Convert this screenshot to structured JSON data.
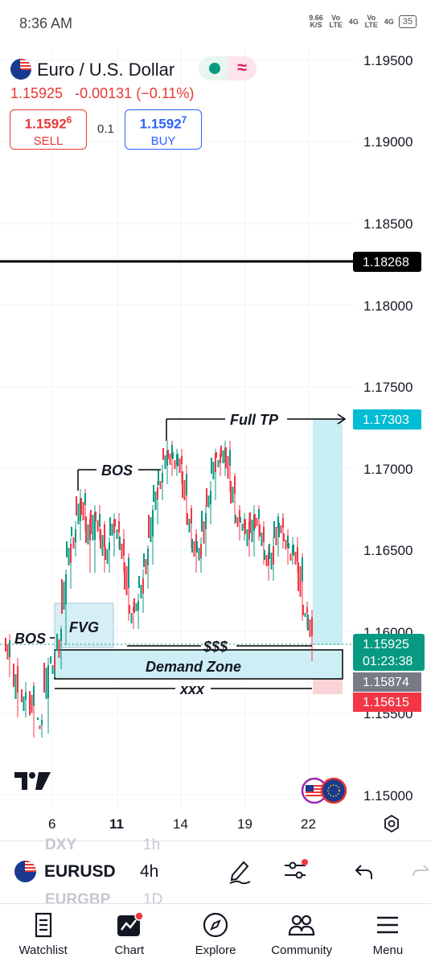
{
  "status_bar": {
    "time": "8:36 AM",
    "net_speed": "9.66",
    "net_unit": "K/S",
    "sig1": "Vo LTE",
    "sig2": "4G",
    "sig3": "Vo LTE",
    "sig4": "4G",
    "battery": "35"
  },
  "header": {
    "title": "Euro / U.S. Dollar",
    "last_price": "1.15925",
    "change": "-0.00131",
    "change_pct": "(−0.11%)",
    "sell": {
      "price_main": "1.1592",
      "price_sup": "6",
      "label": "SELL"
    },
    "buy": {
      "price_main": "1.1592",
      "price_sup": "7",
      "label": "BUY"
    },
    "spread": "0.1"
  },
  "price_axis": {
    "labels": [
      "1.19500",
      "1.19000",
      "1.18500",
      "1.18000",
      "1.17500",
      "1.17000",
      "1.16500",
      "1.16000",
      "1.15500",
      "1.15000"
    ]
  },
  "date_axis": {
    "labels": [
      "6",
      "11",
      "14",
      "19",
      "22"
    ]
  },
  "price_tags": {
    "horizontal_line": "1.18268",
    "full_tp": "1.17303",
    "current": "1.15925",
    "countdown": "01:23:38",
    "entry": "1.15874",
    "stop": "1.15615"
  },
  "annotations": {
    "full_tp": "Full TP",
    "bos_top": "BOS",
    "bos_left": "BOS",
    "fvg": "FVG",
    "sss": "$$$",
    "demand_zone": "Demand Zone",
    "xxx": "xxx"
  },
  "colors": {
    "up": "#089981",
    "down": "#f23645",
    "tp_zone": "#c9eef3",
    "stop_zone": "#f9d3d7",
    "accent_blue": "#2962ff"
  },
  "toolbar": {
    "symbol": "EURUSD",
    "symbol_prev": "DXY",
    "symbol_next": "EURGBP",
    "interval": "4h",
    "interval_prev": "1h",
    "interval_next": "1D"
  },
  "nav": [
    {
      "label": "Watchlist",
      "icon": "watchlist-icon"
    },
    {
      "label": "Chart",
      "icon": "chart-icon"
    },
    {
      "label": "Explore",
      "icon": "compass-icon"
    },
    {
      "label": "Community",
      "icon": "community-icon"
    },
    {
      "label": "Menu",
      "icon": "menu-icon"
    }
  ]
}
